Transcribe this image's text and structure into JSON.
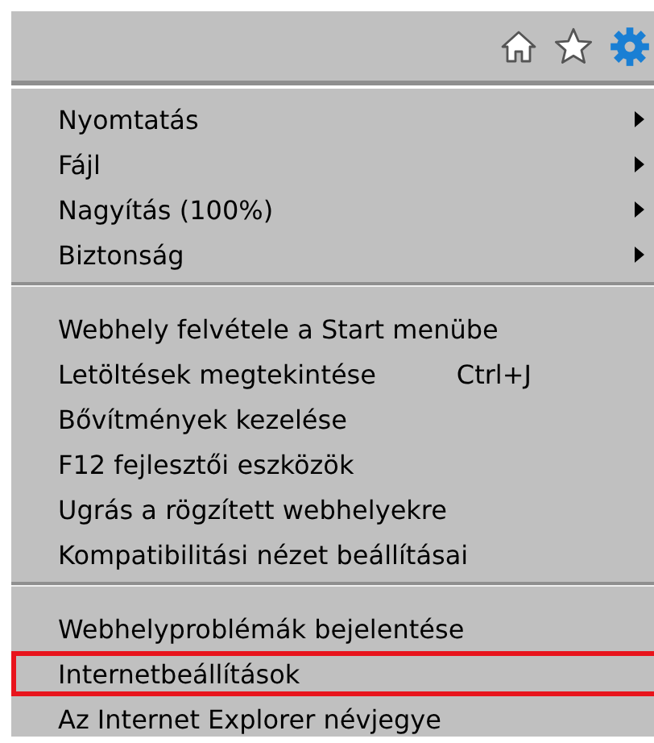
{
  "toolbar": {
    "icons": [
      {
        "kind": "home"
      },
      {
        "kind": "favorites"
      },
      {
        "kind": "settings"
      }
    ]
  },
  "menu": {
    "groups": [
      {
        "items": [
          {
            "label": "Nyomtatás",
            "submenu": true,
            "highlighted": false
          },
          {
            "label": "Fájl",
            "submenu": true,
            "highlighted": false
          },
          {
            "label": "Nagyítás (100%)",
            "submenu": true,
            "highlighted": false
          },
          {
            "label": "Biztonság",
            "submenu": true,
            "highlighted": false
          }
        ]
      },
      {
        "items": [
          {
            "label": "Webhely felvétele a Start menübe",
            "submenu": false,
            "highlighted": false
          },
          {
            "label": "Letöltések megtekintése",
            "shortcut": "Ctrl+J",
            "submenu": false,
            "highlighted": false
          },
          {
            "label": "Bővítmények kezelése",
            "submenu": false,
            "highlighted": false
          },
          {
            "label": "F12 fejlesztői eszközök",
            "submenu": false,
            "highlighted": false
          },
          {
            "label": "Ugrás a rögzített webhelyekre",
            "submenu": false,
            "highlighted": false
          },
          {
            "label": "Kompatibilitási nézet beállításai",
            "submenu": false,
            "highlighted": false
          }
        ]
      },
      {
        "items": [
          {
            "label": "Webhelyproblémák bejelentése",
            "submenu": false,
            "highlighted": false
          },
          {
            "label": "Internetbeállítások",
            "submenu": false,
            "highlighted": true
          },
          {
            "label": "Az Internet Explorer névjegye",
            "submenu": false,
            "highlighted": false
          }
        ]
      }
    ]
  }
}
